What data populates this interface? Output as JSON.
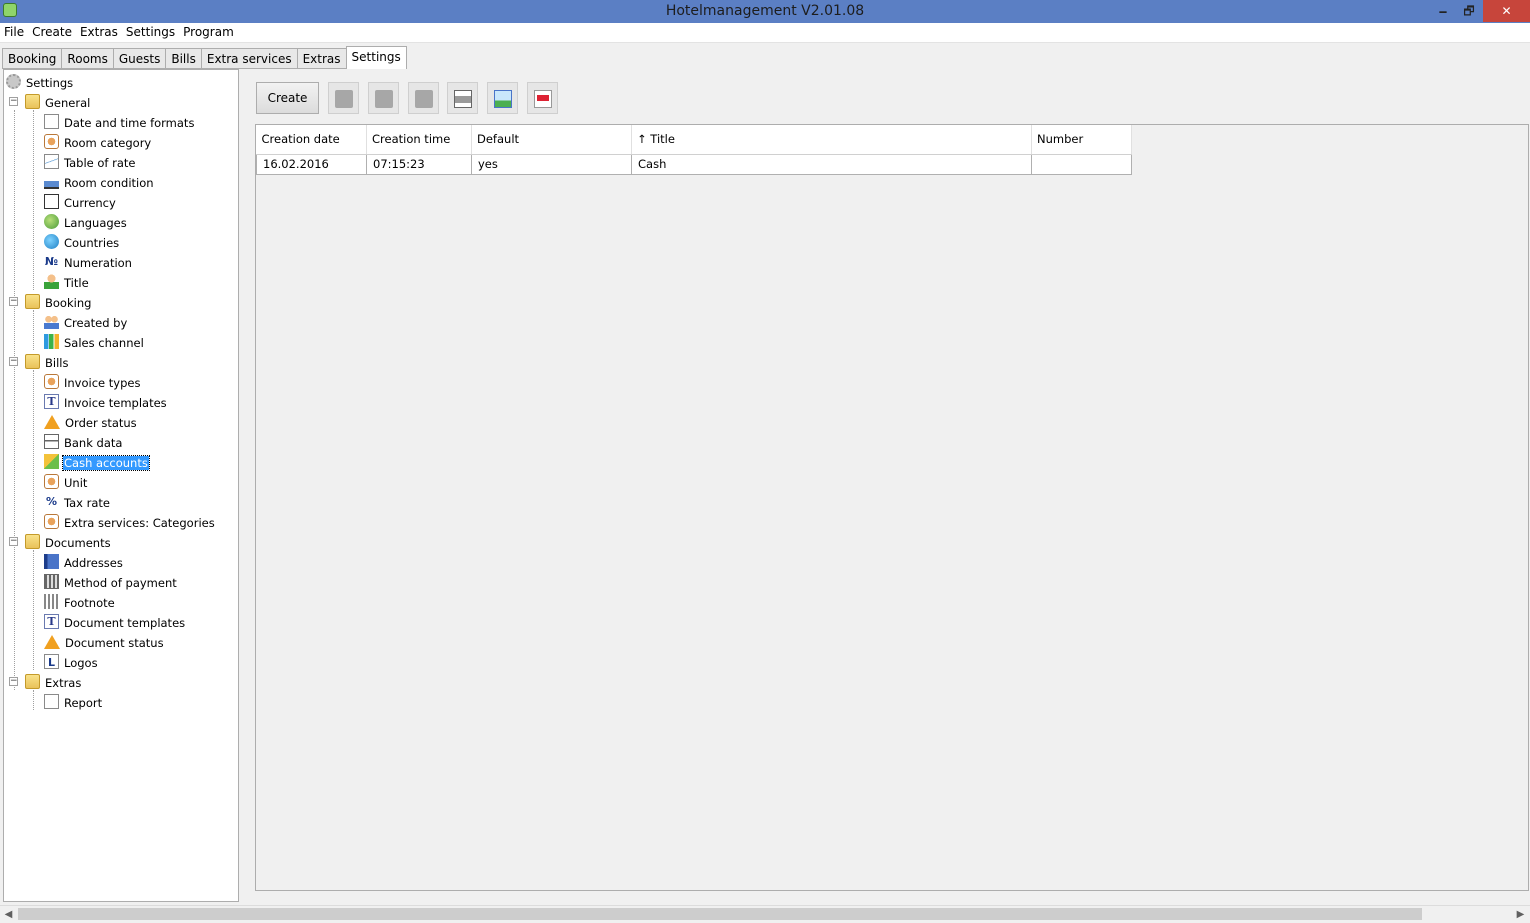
{
  "window": {
    "title": "Hotelmanagement V2.01.08",
    "minimize": "🗕",
    "restore": "🗗",
    "close": "✕"
  },
  "menu": [
    "File",
    "Create",
    "Extras",
    "Settings",
    "Program"
  ],
  "tabs": [
    "Booking",
    "Rooms",
    "Guests",
    "Bills",
    "Extra services",
    "Extras",
    "Settings"
  ],
  "tree": {
    "root": "Settings",
    "general": {
      "label": "General",
      "items": [
        "Date and time formats",
        "Room category",
        "Table of rate",
        "Room condition",
        "Currency",
        "Languages",
        "Countries",
        "Numeration",
        "Title"
      ]
    },
    "booking": {
      "label": "Booking",
      "items": [
        "Created by",
        "Sales channel"
      ]
    },
    "bills": {
      "label": "Bills",
      "items": [
        "Invoice types",
        "Invoice templates",
        "Order status",
        "Bank data",
        "Cash accounts",
        "Unit",
        "Tax rate",
        "Extra services: Categories"
      ]
    },
    "documents": {
      "label": "Documents",
      "items": [
        "Addresses",
        "Method of payment",
        "Footnote",
        "Document templates",
        "Document status",
        "Logos"
      ]
    },
    "extras": {
      "label": "Extras",
      "items": [
        "Report"
      ]
    },
    "icons": {
      "numeration": "№",
      "tax_rate": "%",
      "logos": "L"
    }
  },
  "toolbar": {
    "create_label": "Create"
  },
  "grid": {
    "columns": [
      "Creation date",
      "Creation time",
      "Default",
      "↑ Title",
      "Number"
    ],
    "rows": [
      [
        "16.02.2016",
        "07:15:23",
        "yes",
        "Cash",
        ""
      ]
    ]
  },
  "scrollbar": {
    "left": "◀",
    "right": "▶"
  }
}
